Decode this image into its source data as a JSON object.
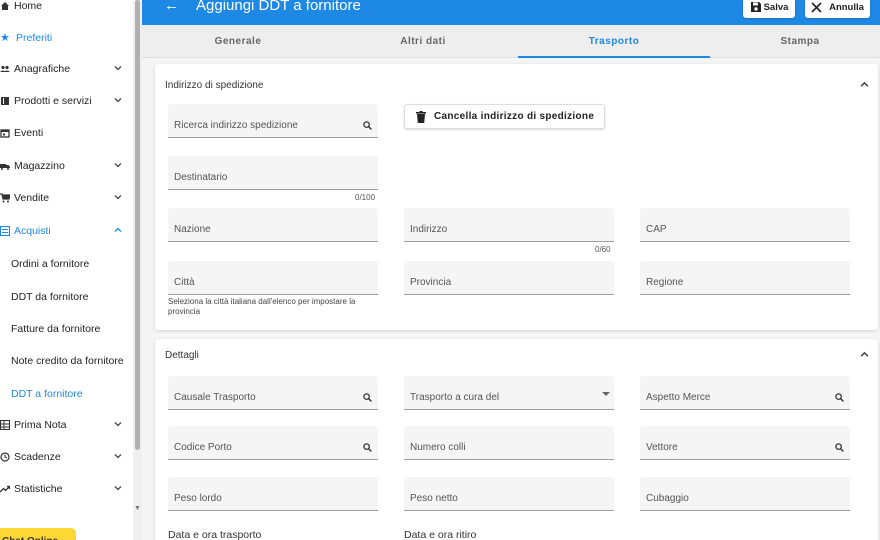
{
  "sidebar": {
    "items": [
      {
        "label": "Home",
        "icon": "home-icon"
      },
      {
        "label": "Preferiti",
        "icon": "star-icon"
      },
      {
        "label": "Anagrafiche",
        "icon": "people-icon"
      },
      {
        "label": "Prodotti e servizi",
        "icon": "book-icon"
      },
      {
        "label": "Eventi",
        "icon": "calendar-icon"
      },
      {
        "label": "Magazzino",
        "icon": "truck-icon"
      },
      {
        "label": "Vendite",
        "icon": "cart-icon"
      },
      {
        "label": "Acquisti",
        "icon": "list-icon"
      },
      {
        "label": "Ordini a fornitore"
      },
      {
        "label": "DDT da fornitore"
      },
      {
        "label": "Fatture da fornitore"
      },
      {
        "label": "Note credito da fornitore"
      },
      {
        "label": "DDT a fornitore"
      },
      {
        "label": "Prima Nota",
        "icon": "table-icon"
      },
      {
        "label": "Scadenze",
        "icon": "clock-icon"
      },
      {
        "label": "Statistiche",
        "icon": "trend-icon"
      }
    ],
    "chat_label": "Chat Online"
  },
  "header": {
    "title": "Aggiungi DDT a fornitore",
    "save_label": "Salva",
    "cancel_label": "Annulla"
  },
  "tabs": [
    "Generale",
    "Altri dati",
    "Trasporto",
    "Stampa"
  ],
  "shipping": {
    "title": "Indirizzo di spedizione",
    "search_label": "Ricerca indirizzo spedizione",
    "delete_button": "Cancella indirizzo di spedizione",
    "recipient_label": "Destinatario",
    "recipient_counter": "0/100",
    "nation_label": "Nazione",
    "address_label": "Indirizzo",
    "address_counter": "0/60",
    "cap_label": "CAP",
    "city_label": "Città",
    "city_hint": "Seleziona la città italiana dall'elenco per impostare la provincia",
    "province_label": "Provincia",
    "region_label": "Regione"
  },
  "details": {
    "title": "Dettagli",
    "causale_label": "Causale Trasporto",
    "trasporto_label": "Trasporto a cura del",
    "aspetto_label": "Aspetto Merce",
    "porto_label": "Codice Porto",
    "colli_label": "Numero colli",
    "vettore_label": "Vettore",
    "peso_lordo_label": "Peso lordo",
    "peso_netto_label": "Peso netto",
    "cubaggio_label": "Cubaggio",
    "data_trasporto_label": "Data e ora trasporto",
    "data_ritiro_label": "Data e ora ritiro"
  },
  "colors": {
    "primary": "#1e88e5",
    "chat": "#fdd835"
  }
}
